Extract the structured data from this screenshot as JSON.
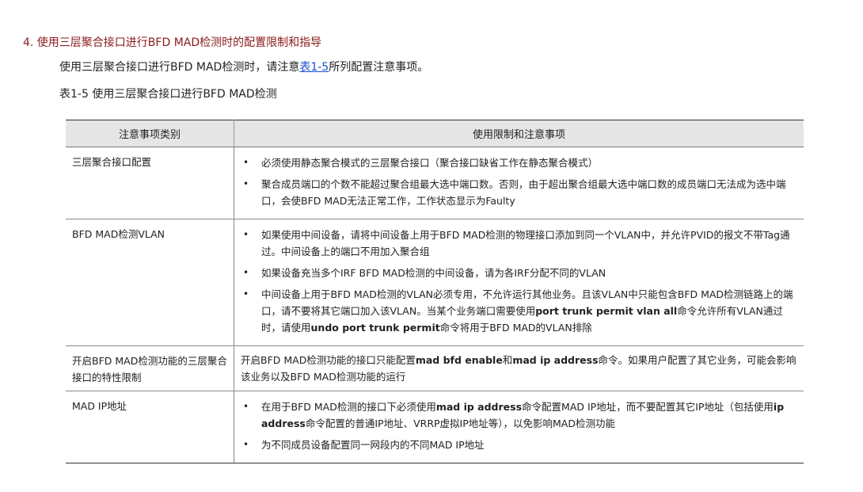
{
  "heading": "4. 使用三层聚合接口进行BFD MAD检测时的配置限制和指导",
  "intro": {
    "before": "使用三层聚合接口进行BFD MAD检测时，请注意",
    "link": "表1-5",
    "after": "所列配置注意事项。"
  },
  "caption": "表1-5 使用三层聚合接口进行BFD MAD检测",
  "table": {
    "headers": [
      "注意事项类别",
      "使用限制和注意事项"
    ],
    "rows": [
      {
        "category": "三层聚合接口配置",
        "items": [
          "必须使用静态聚合模式的三层聚合接口（聚合接口缺省工作在静态聚合模式）",
          "聚合成员端口的个数不能超过聚合组最大选中端口数。否则，由于超出聚合组最大选中端口数的成员端口无法成为选中端口，会使BFD MAD无法正常工作，工作状态显示为Faulty"
        ]
      },
      {
        "category": "BFD MAD检测VLAN",
        "items": [
          "如果使用中间设备，请将中间设备上用于BFD MAD检测的物理接口添加到同一个VLAN中，并允许PVID的报文不带Tag通过。中间设备上的端口不用加入聚合组",
          "如果设备充当多个IRF BFD MAD检测的中间设备，请为各IRF分配不同的VLAN",
          {
            "p1": "中间设备上用于BFD MAD检测的VLAN必须专用，不允许运行其他业务。且该VLAN中只能包含BFD MAD检测链路上的端口，请不要将其它端口加入该VLAN。当某个业务端口需要使用",
            "b1": "port trunk permit vlan all",
            "p2": "命令允许所有VLAN通过时，请使用",
            "b2": "undo port trunk permit",
            "p3": "命令将用于BFD MAD的VLAN排除"
          }
        ]
      },
      {
        "category": "开启BFD MAD检测功能的三层聚合接口的特性限制",
        "text": {
          "p1": "开启BFD MAD检测功能的接口只能配置",
          "b1": "mad bfd enable",
          "p2": "和",
          "b2": "mad ip address",
          "p3": "命令。如果用户配置了其它业务，可能会影响该业务以及BFD MAD检测功能的运行"
        }
      },
      {
        "category": "MAD IP地址",
        "items": [
          {
            "p1": "在用于BFD MAD检测的接口下必须使用",
            "b1": "mad ip address",
            "p2": "命令配置MAD IP地址，而不要配置其它IP地址（包括使用",
            "b2": "ip address",
            "p3": "命令配置的普通IP地址、VRRP虚拟IP地址等），以免影响MAD检测功能"
          },
          "为不同成员设备配置同一网段内的不同MAD IP地址"
        ]
      }
    ]
  }
}
